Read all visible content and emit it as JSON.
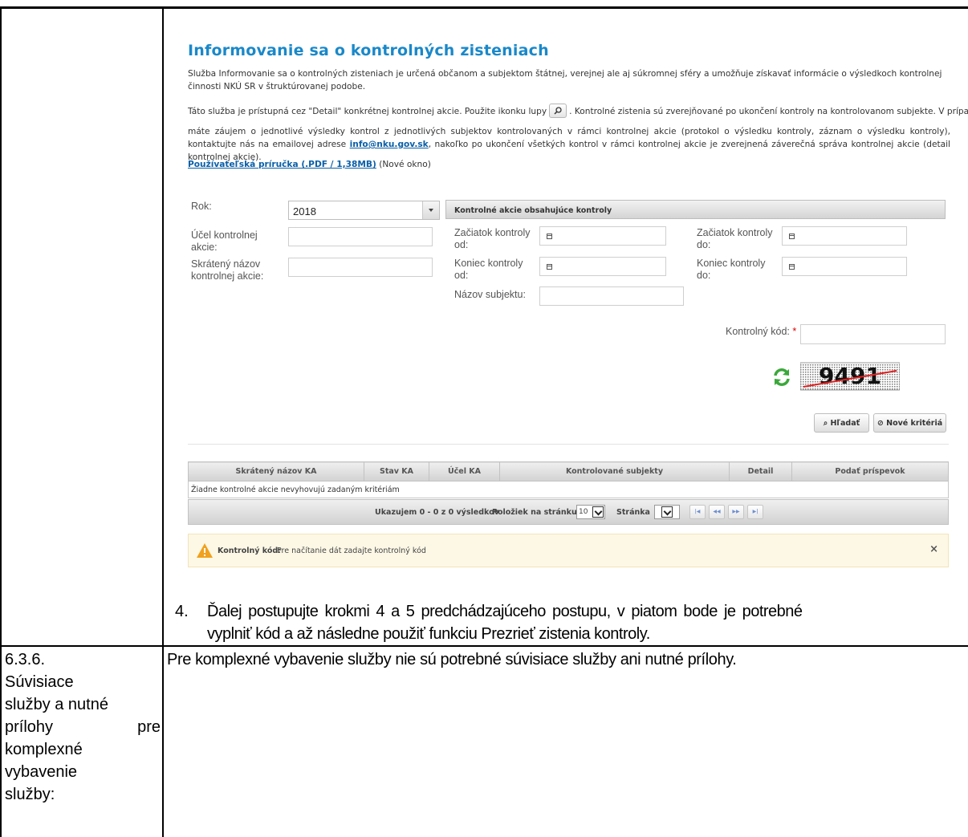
{
  "service": {
    "title": "Informovanie sa o kontrolných zisteniach",
    "intro": "Služba Informovanie sa o kontrolných zisteniach je určená občanom a subjektom štátnej, verejnej ale aj súkromnej sféry a umožňuje získavať informácie o výsledkoch kontrolnej činnosti NKÚ SR v štruktúrovanej podobe.",
    "access_1": "Táto služba je prístupná cez \"Detail\" konkrétnej kontrolnej akcie. Použite ikonku lupy",
    "access_2": ". Kontrolné zistenia sú zverejňované po ukončení kontroly na kontrolovanom subjekte. V prípade, ak",
    "access_3": "máte záujem o jednotlivé výsledky kontrol z jednotlivých subjektov kontrolovaných v rámci kontrolnej akcie (protokol o výsledku kontroly, záznam o výsledku kontroly), kontaktujte nás na emailovej adrese",
    "email": "info@nku.gov.sk",
    "access_4": ", nakoľko po ukončení všetkých kontrol v rámci kontrolnej akcie je zverejnená záverečná správa kontrolnej akcie (detail kontrolnej akcie).",
    "manual_link": "Používateľská príručka (.PDF / 1,38MB)",
    "manual_note": " (Nové okno)",
    "lupa_icon": "magnifier-icon"
  },
  "form": {
    "rok_label": "Rok:",
    "rok_value": "2018",
    "panel_title": "Kontrolné akcie obsahujúce kontroly",
    "ucel_label": "Účel kontrolnej akcie:",
    "skrateny_label": "Skrátený názov kontrolnej akcie:",
    "zaciatok_od_label": "Začiatok kontroly od:",
    "zaciatok_do_label": "Začiatok kontroly do:",
    "koniec_od_label": "Koniec kontroly od:",
    "koniec_do_label": "Koniec kontroly do:",
    "nazov_subjektu_label": "Názov subjektu:",
    "kod_label": "Kontrolný kód:",
    "required_mark": "*",
    "captcha_text": "9491",
    "search_button": "Hľadať",
    "reset_button": "Nové kritériá"
  },
  "table": {
    "columns": [
      "Skrátený názov KA",
      "Stav KA",
      "Účel KA",
      "Kontrolované subjekty",
      "Detail",
      "Podať príspevok"
    ],
    "empty_message": "Žiadne kontrolné akcie nevyhovujú zadaným kritériám",
    "showing": "Ukazujem 0 - 0 z 0 výsledkov",
    "per_page_label": "Položiek na stránku",
    "per_page_value": "10",
    "page_label": "Stránka",
    "page_value": ""
  },
  "alert": {
    "label": "Kontrolný kód:",
    "message": "Pre načítanie dát zadajte kontrolný kód",
    "close": "×"
  },
  "document": {
    "step_number": "4.",
    "step_text_1": "Ďalej postupujte krokmi 4 a 5 predchádzajúceho postupu, v piatom bode je potrebné",
    "step_text_2": "vyplniť kód a až následne použiť funkciu Prezrieť zistenia kontroly.",
    "row_label_lines": [
      "6.3.6.",
      "Súvisiace",
      "služby a nutné",
      "prílohy pre",
      "komplexné",
      "vybavenie",
      "služby:"
    ],
    "row_text": "Pre komplexné vybavenie služby nie sú potrebné súvisiace služby ani nutné prílohy."
  },
  "colors": {
    "title_blue": "#1a88c9",
    "link_blue": "#0a5fa8",
    "warning_bg": "#fdf8e6",
    "warning_icon": "#f0a11e",
    "refresh_green": "#3aa83a"
  }
}
